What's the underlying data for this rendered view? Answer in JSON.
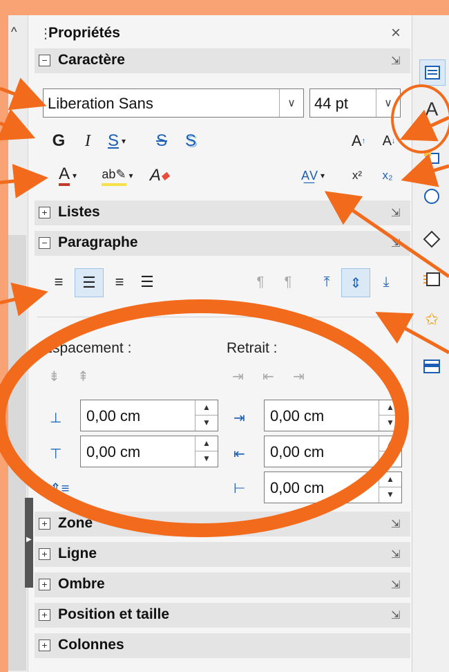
{
  "header": {
    "title": "Propriétés"
  },
  "sections": {
    "caractere": "Caractère",
    "listes": "Listes",
    "paragraphe": "Paragraphe",
    "zone": "Zone",
    "ligne": "Ligne",
    "ombre": "Ombre",
    "position": "Position et taille",
    "colonnes": "Colonnes"
  },
  "character": {
    "font_name": "Liberation Sans",
    "font_size": "44 pt",
    "bold": "G",
    "italic": "I",
    "underline": "S",
    "strike": "S",
    "shadow": "S",
    "font_color_glyph": "A",
    "superscript": "x²",
    "subscript": "x₂"
  },
  "paragraph": {
    "spacing_label": "Espacement :",
    "indent_label": "Retrait :",
    "above": "0,00 cm",
    "below": "0,00 cm",
    "indent_before": "0,00 cm",
    "indent_after": "0,00 cm",
    "indent_first": "0,00 cm"
  },
  "colors": {
    "background": "#F9A274",
    "annotation": "#F26B1D",
    "highlight": "#dbe9f7",
    "font_color_bar": "#c0392b",
    "highlight_bar": "#f6e14b"
  }
}
